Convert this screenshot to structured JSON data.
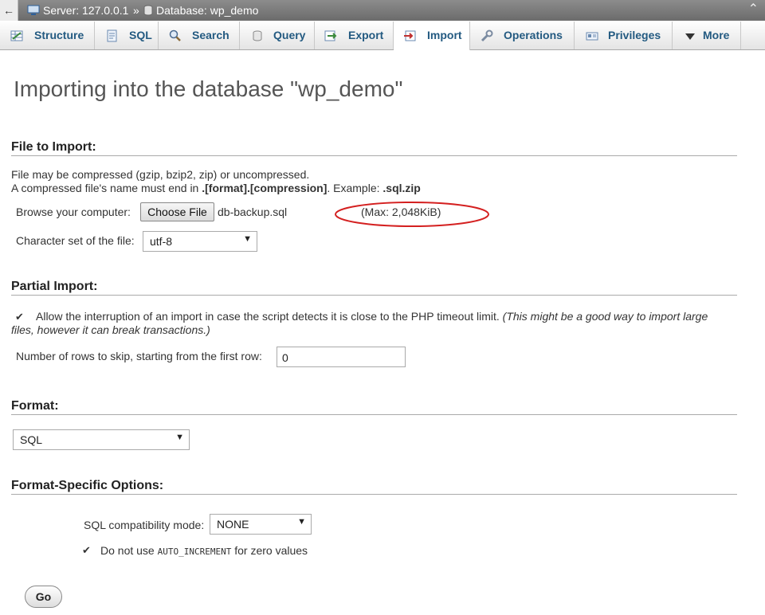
{
  "breadcrumb": {
    "back_icon": "←",
    "server": "Server: 127.0.0.1",
    "separator": "»",
    "database": "Database: wp_demo",
    "collapse_icon": "⌃"
  },
  "tabs": [
    {
      "label": "Structure",
      "icon": "structure-icon"
    },
    {
      "label": "SQL",
      "icon": "sql-icon"
    },
    {
      "label": "Search",
      "icon": "search-icon"
    },
    {
      "label": "Query",
      "icon": "query-icon"
    },
    {
      "label": "Export",
      "icon": "export-icon"
    },
    {
      "label": "Import",
      "icon": "import-icon",
      "active": true
    },
    {
      "label": "Operations",
      "icon": "wrench-icon"
    },
    {
      "label": "Privileges",
      "icon": "privileges-icon"
    },
    {
      "label": "More",
      "icon": "caret-down-icon"
    }
  ],
  "page_title": "Importing into the database \"wp_demo\"",
  "file_import": {
    "title": "File to Import:",
    "line1": "File may be compressed (gzip, bzip2, zip) or uncompressed.",
    "line2_pre": "A compressed file's name must end in ",
    "line2_bold": ".[format].[compression]",
    "line2_mid": ". Example: ",
    "line2_example": ".sql.zip",
    "browse_label": "Browse your computer:",
    "choose_button": "Choose File",
    "file_name": "db-backup.sql",
    "max_size": "(Max: 2,048KiB)",
    "charset_label": "Character set of the file:",
    "charset_value": "utf-8"
  },
  "partial_import": {
    "title": "Partial Import:",
    "allow_interrupt_checked": true,
    "allow_interrupt_text": "Allow the interruption of an import in case the script detects it is close to the PHP timeout limit.",
    "allow_interrupt_note_1": "(This might be a good way to import large",
    "allow_interrupt_note_2": "files, however it can break transactions.)",
    "skip_label": "Number of rows to skip, starting from the first row:",
    "skip_value": "0"
  },
  "format": {
    "title": "Format:",
    "value": "SQL"
  },
  "format_options": {
    "title": "Format-Specific Options:",
    "compat_label": "SQL compatibility mode:",
    "compat_value": "NONE",
    "auto_inc_checked": true,
    "auto_inc_pre": "Do not use ",
    "auto_inc_code": "AUTO_INCREMENT",
    "auto_inc_post": " for zero values"
  },
  "go_button": "Go",
  "colors": {
    "tab_text": "#235a81",
    "annotation_ellipse": "#d42020"
  }
}
